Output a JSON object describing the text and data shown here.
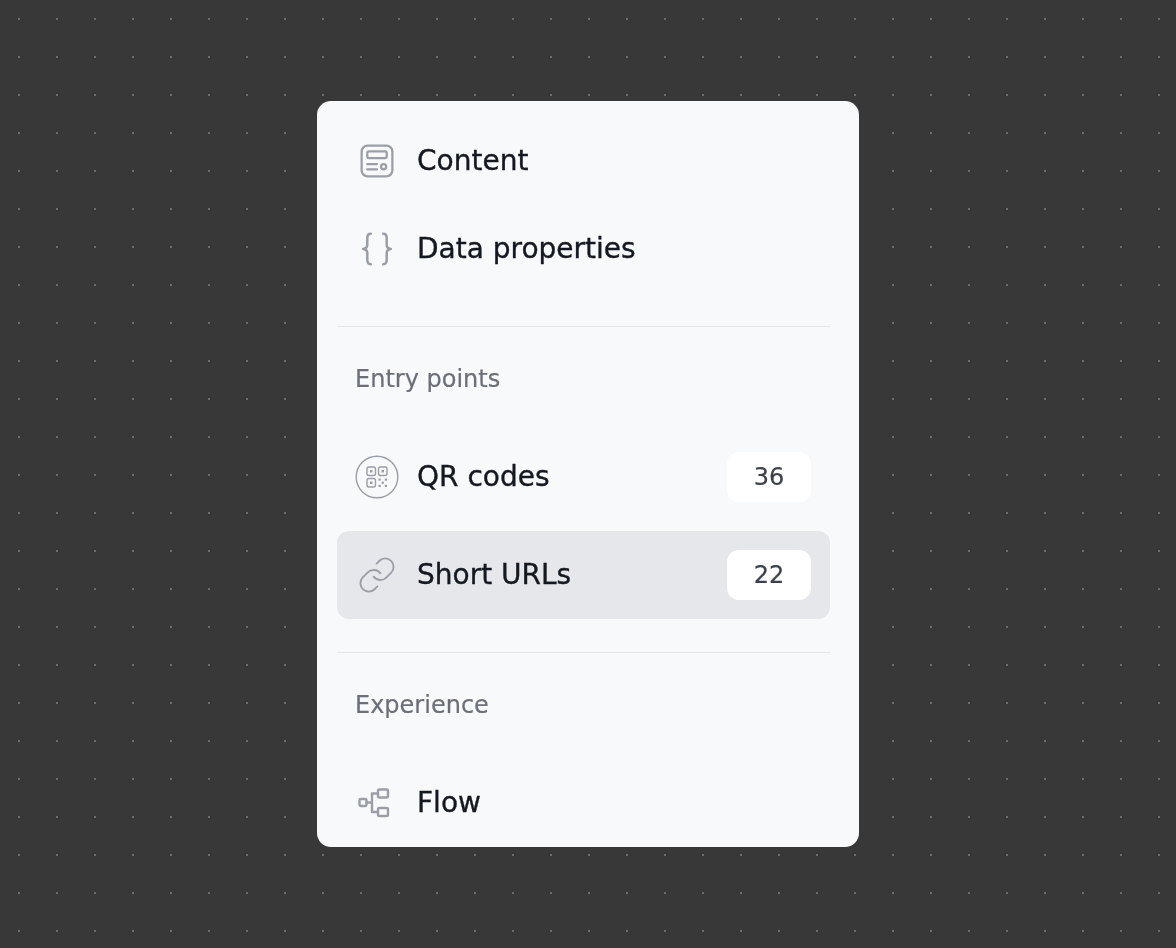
{
  "panel": {
    "items": [
      {
        "label": "Content",
        "selected": false
      },
      {
        "label": "Data properties",
        "selected": false
      }
    ],
    "sections": [
      {
        "title": "Entry points",
        "items": [
          {
            "label": "QR codes",
            "count": "36",
            "selected": false
          },
          {
            "label": "Short URLs",
            "count": "22",
            "selected": true
          }
        ]
      },
      {
        "title": "Experience",
        "items": [
          {
            "label": "Flow",
            "selected": false
          }
        ]
      }
    ]
  }
}
